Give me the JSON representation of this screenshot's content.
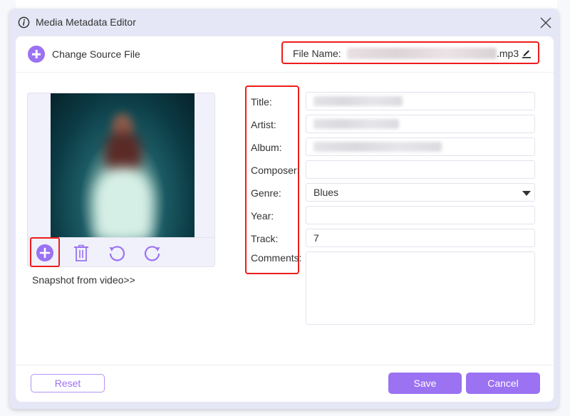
{
  "dialog": {
    "title": "Media Metadata Editor",
    "close_icon": "close-icon",
    "info_icon": "info-icon"
  },
  "toolbar": {
    "change_source_label": "Change Source File",
    "file_name_label": "File Name:",
    "file_name_extension": ".mp3",
    "file_name_hidden": true
  },
  "cover": {
    "tools": [
      "add-cover-icon",
      "delete-icon",
      "rotate-left-icon",
      "rotate-right-icon"
    ],
    "snapshot_label": "Snapshot from video>>"
  },
  "fields": {
    "title": {
      "label": "Title:",
      "value_blurred": true
    },
    "artist": {
      "label": "Artist:",
      "value_blurred": true
    },
    "album": {
      "label": "Album:",
      "value_blurred": true
    },
    "composer": {
      "label": "Composer:",
      "value": ""
    },
    "genre": {
      "label": "Genre:",
      "value": "Blues"
    },
    "year": {
      "label": "Year:",
      "value": ""
    },
    "track": {
      "label": "Track:",
      "value": "7"
    },
    "comments": {
      "label": "Comments:",
      "value": ""
    }
  },
  "footer": {
    "reset_label": "Reset",
    "save_label": "Save",
    "cancel_label": "Cancel"
  },
  "colors": {
    "accent": "#9b72f2",
    "highlight": "#ee1c1c",
    "dialog_bg": "#e6e7f6"
  }
}
